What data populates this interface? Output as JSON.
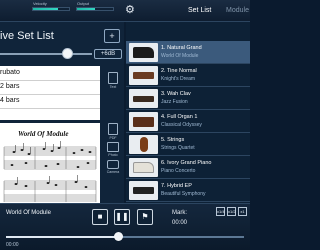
{
  "topbar": {
    "velocity_label": "Velocity",
    "velocity_level": 0.7,
    "output_label": "Output",
    "output_level": 0.5,
    "tabs": [
      {
        "label": "Set List"
      },
      {
        "label": "Module"
      }
    ]
  },
  "setlist": {
    "title": "ive Set List",
    "add_label": "+",
    "gain": "+6dB",
    "memo": [
      "rubato",
      "2 bars",
      "4 bars"
    ]
  },
  "score": {
    "title": "World Of Module"
  },
  "side_tools": [
    {
      "label": "Text"
    },
    {
      "label": "PDF"
    },
    {
      "label": "Photo"
    },
    {
      "label": "Camera"
    }
  ],
  "voices": [
    {
      "name": "1. Natural Grand",
      "sub": "World Of Module",
      "selected": true,
      "icon": "grand-piano-icon"
    },
    {
      "name": "2. Tine Normal",
      "sub": "Knight's Dream",
      "selected": false,
      "icon": "electric-piano-icon"
    },
    {
      "name": "3. Wah Clav",
      "sub": "Jazz Fusion",
      "selected": false,
      "icon": "clavinet-icon"
    },
    {
      "name": "4. Full Organ 1",
      "sub": "Classical Odyssey",
      "selected": false,
      "icon": "organ-icon"
    },
    {
      "name": "5. Strings",
      "sub": "Strings Quartet",
      "selected": false,
      "icon": "strings-icon"
    },
    {
      "name": "6. Ivory Grand Piano",
      "sub": "Piano Concerto",
      "selected": false,
      "icon": "grand-piano-icon"
    },
    {
      "name": "7. Hybrid EP",
      "sub": "Beautiful Symphony",
      "selected": false,
      "icon": "electric-piano-icon"
    }
  ],
  "player": {
    "song": "World Of Module",
    "mark_label": "Mark:",
    "measure_label": "00:00",
    "speeds": [
      "x1/4",
      "x1/2",
      "x1"
    ],
    "position": 0.47,
    "time": "00:00"
  }
}
